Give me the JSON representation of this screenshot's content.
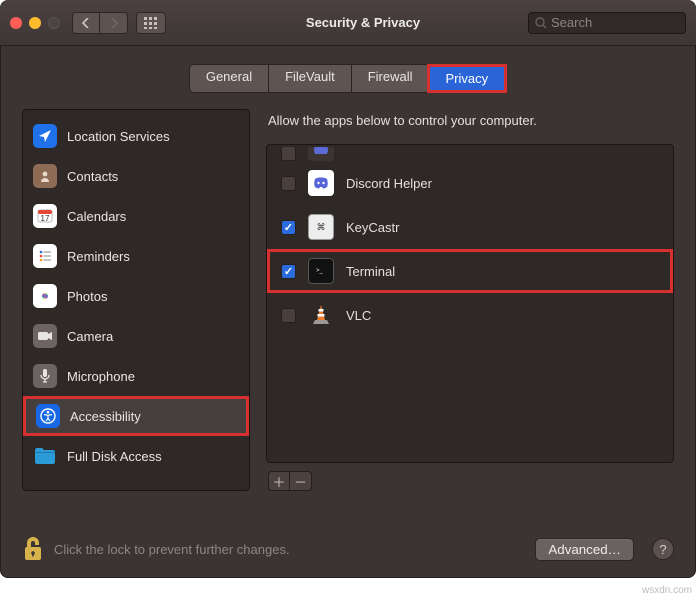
{
  "window": {
    "title": "Security & Privacy"
  },
  "search": {
    "placeholder": "Search"
  },
  "tabs": [
    {
      "label": "General",
      "active": false
    },
    {
      "label": "FileVault",
      "active": false
    },
    {
      "label": "Firewall",
      "active": false
    },
    {
      "label": "Privacy",
      "active": true
    }
  ],
  "sidebar": [
    {
      "label": "Location Services",
      "icon": "location",
      "bg": "#2072ea"
    },
    {
      "label": "Contacts",
      "icon": "contacts",
      "bg": "#8d6b55"
    },
    {
      "label": "Calendars",
      "icon": "calendar",
      "bg": "#ffffff"
    },
    {
      "label": "Reminders",
      "icon": "reminders",
      "bg": "#ffffff"
    },
    {
      "label": "Photos",
      "icon": "photos",
      "bg": "#ffffff"
    },
    {
      "label": "Camera",
      "icon": "camera",
      "bg": "#6b6462"
    },
    {
      "label": "Microphone",
      "icon": "microphone",
      "bg": "#6b6462"
    },
    {
      "label": "Accessibility",
      "icon": "accessibility",
      "bg": "#1668e3",
      "selected": true,
      "highlight": true
    },
    {
      "label": "Full Disk Access",
      "icon": "folder",
      "bg": "#2a9bd6"
    }
  ],
  "panel": {
    "instruction": "Allow the apps below to control your computer.",
    "apps": [
      {
        "label": "Discord Helper",
        "checked": false,
        "icon": "discord"
      },
      {
        "label": "KeyCastr",
        "checked": true,
        "icon": "keycastr"
      },
      {
        "label": "Terminal",
        "checked": true,
        "icon": "terminal",
        "highlight": true
      },
      {
        "label": "VLC",
        "checked": false,
        "icon": "vlc"
      }
    ]
  },
  "footer": {
    "lockText": "Click the lock to prevent further changes.",
    "advanced": "Advanced…"
  },
  "watermark": "wsxdn.com"
}
